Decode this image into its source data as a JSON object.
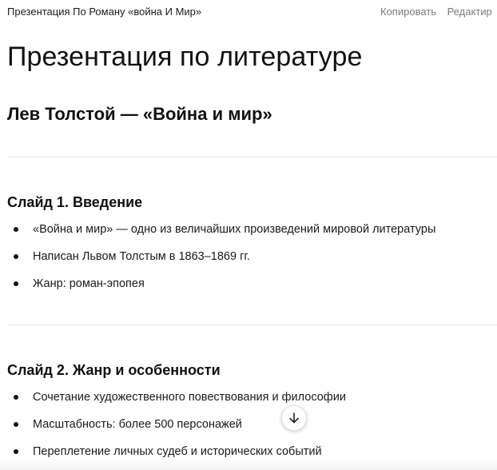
{
  "header": {
    "doc_title": "Презентация По Роману «война И Мир»",
    "copy_label": "Копировать",
    "edit_label": "Редактир"
  },
  "document": {
    "title": "Презентация по литературе",
    "subtitle": "Лев Толстой — «Война и мир»",
    "slides": [
      {
        "heading": "Слайд 1. Введение",
        "bullets": [
          "«Война и мир» — одно из величайших произведений мировой литературы",
          "Написан Львом Толстым в 1863–1869 гг.",
          "Жанр: роман-эпопея"
        ]
      },
      {
        "heading": "Слайд 2. Жанр и особенности",
        "bullets": [
          "Сочетание художественного повествования и философии",
          "Масштабность: более 500 персонажей",
          "Переплетение личных судеб и исторических событий"
        ]
      }
    ]
  },
  "controls": {
    "scroll_down_icon": "arrow-down-icon"
  }
}
